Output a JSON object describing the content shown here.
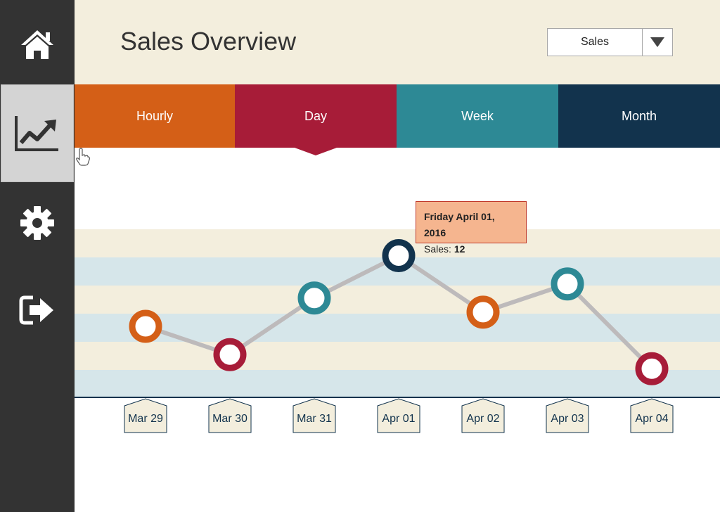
{
  "header": {
    "title": "Sales Overview"
  },
  "metric_select": {
    "value": "Sales"
  },
  "sidebar": {
    "items": [
      {
        "name": "home",
        "icon": "home-icon"
      },
      {
        "name": "analytics",
        "icon": "chart-icon",
        "active": true
      },
      {
        "name": "settings",
        "icon": "gear-icon"
      },
      {
        "name": "logout",
        "icon": "logout-icon"
      }
    ]
  },
  "tabs": [
    {
      "label": "Hourly",
      "color": "#d45f17"
    },
    {
      "label": "Day",
      "color": "#a71c38",
      "active": true
    },
    {
      "label": "Week",
      "color": "#2d8995"
    },
    {
      "label": "Month",
      "color": "#12334d"
    }
  ],
  "tooltip": {
    "date": "Friday April 01, 2016",
    "label": "Sales:",
    "value": "12"
  },
  "colors": {
    "sidebar": "#333333",
    "header_bg": "#f3eedd",
    "band_cream": "#f3eedd",
    "band_blue": "#d6e6ea",
    "line": "#bdbabb",
    "axis": "#12334d"
  },
  "chart_data": {
    "type": "line",
    "categories": [
      "Mar 29",
      "Mar 30",
      "Mar 31",
      "Apr 01",
      "Apr 02",
      "Apr 03",
      "Apr 04"
    ],
    "values": [
      7,
      5,
      9,
      12,
      8,
      10,
      4
    ],
    "point_colors": [
      "#d45f17",
      "#a71c38",
      "#2d8995",
      "#12334d",
      "#d45f17",
      "#2d8995",
      "#a71c38"
    ],
    "ylim": [
      0,
      14
    ],
    "grid": "alternating horizontal bands"
  }
}
